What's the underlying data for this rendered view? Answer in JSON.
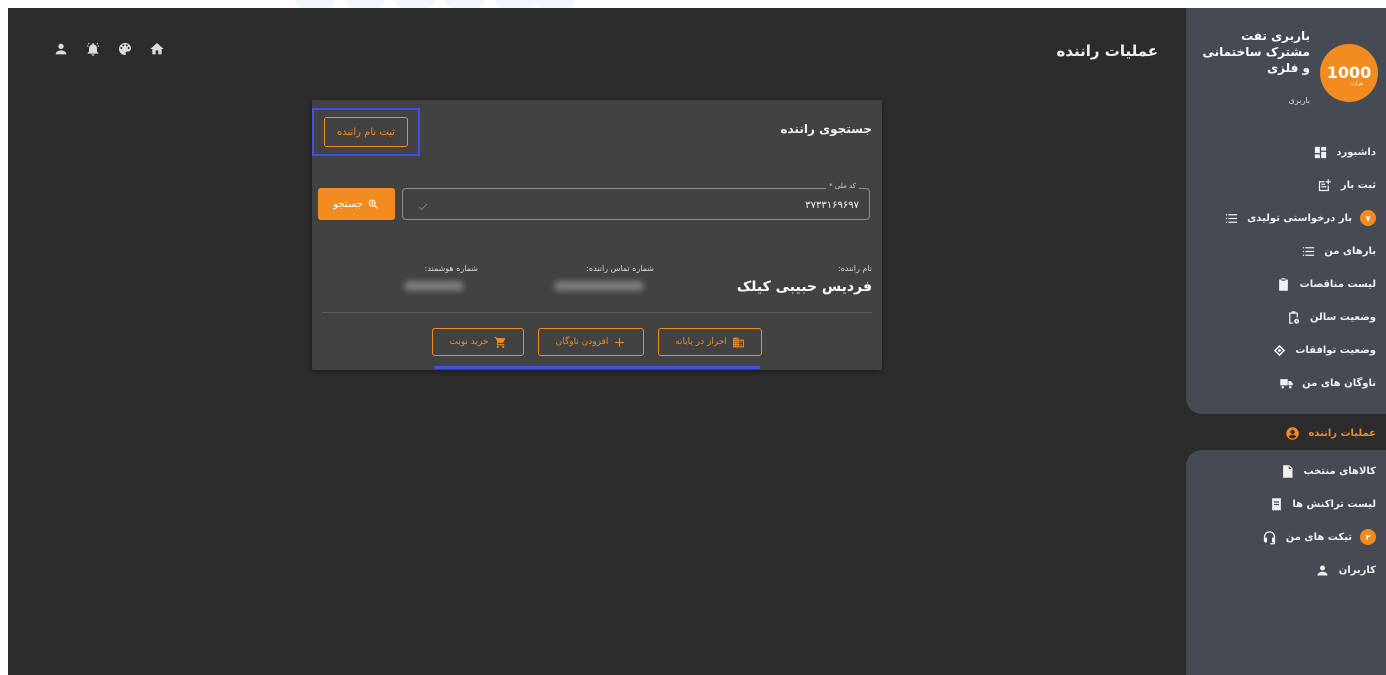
{
  "page": {
    "title": "عملیات راننده"
  },
  "top_icons": [
    "home-icon",
    "palette-icon",
    "notification-icon",
    "user-icon"
  ],
  "card": {
    "title": "جستجوی راننده",
    "register_button": "ثبت نام راننده",
    "national_code": {
      "label": "کد ملی *",
      "value": "۳۷۳۳۱۶۹۶۹۷"
    },
    "search_button": "جستجو",
    "driver_name_label": "نام راننده:",
    "driver_name": "فردیس حبیبی کیلک",
    "driver_phone_label": "شماره تماس راننده:",
    "smart_number_label": "شماره هوشمند:",
    "actions": {
      "terminal_auth": "احراز در پایانه",
      "add_fleet": "افزودن ناوگان",
      "buy_turn": "خرید نوبت"
    }
  },
  "sidebar": {
    "brand_name": "باربری تفت مشترک ساختمانی و فلزی",
    "brand_sub": "باربری",
    "items": [
      {
        "label": "داشبورد",
        "icon": "dashboard-icon"
      },
      {
        "label": "ثبت بار",
        "icon": "add-cargo-icon"
      },
      {
        "label": "بار درخواستی تولیدی",
        "icon": "list-icon",
        "badge": "۷"
      },
      {
        "label": "بارهای من",
        "icon": "list-icon"
      },
      {
        "label": "لیست مناقصات",
        "icon": "clipboard-icon"
      },
      {
        "label": "وضعیت سالن",
        "icon": "clipboard-clock-icon"
      },
      {
        "label": "وضعیت توافقات",
        "icon": "handshake-icon"
      },
      {
        "label": "ناوگان های من",
        "icon": "truck-icon"
      },
      {
        "label": "عملیات راننده",
        "icon": "account-circle-icon",
        "active": true
      },
      {
        "label": "کالاهای منتخب",
        "icon": "file-check-icon"
      },
      {
        "label": "لیست تراکنش ها",
        "icon": "receipt-icon"
      },
      {
        "label": "تیکت های من",
        "icon": "support-icon",
        "badge": "۲"
      },
      {
        "label": "کاربران",
        "icon": "person-icon"
      }
    ]
  },
  "colors": {
    "accent": "#f28b20",
    "highlight": "#3f51e6",
    "background": "#2c2c2c",
    "card": "#424242",
    "sidebar": "#464a53"
  }
}
